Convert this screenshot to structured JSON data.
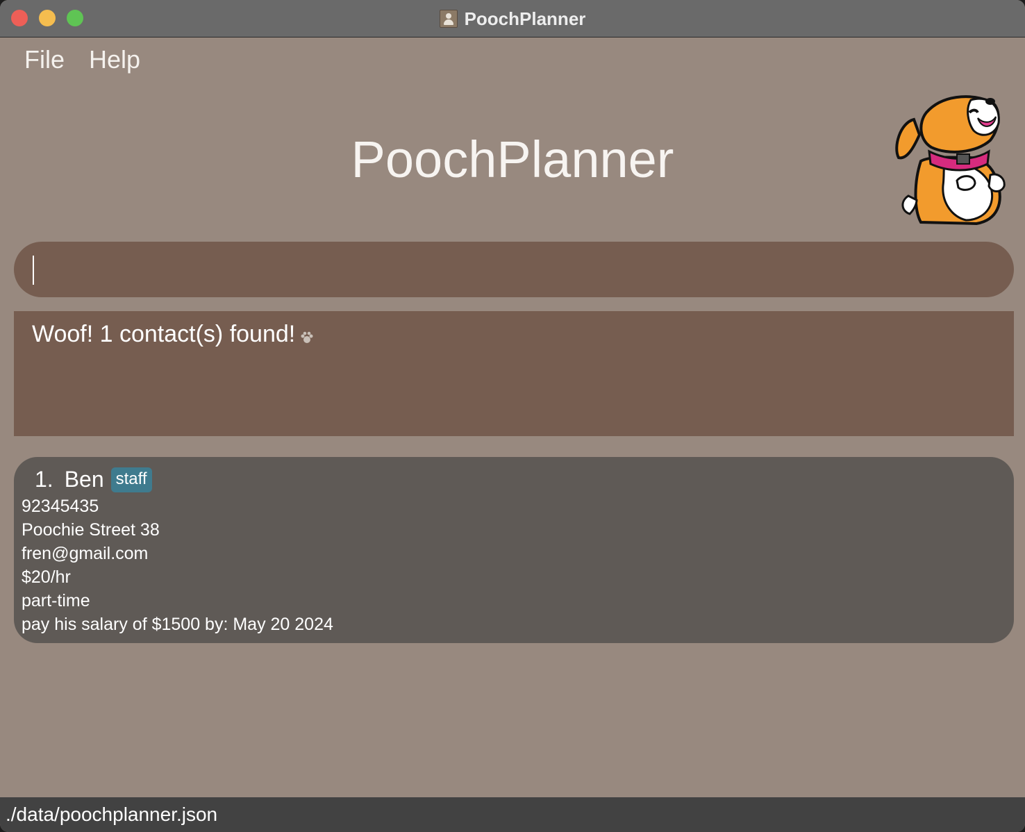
{
  "window": {
    "title": "PoochPlanner",
    "app_icon": "contact-book-icon"
  },
  "menu": {
    "file": "File",
    "help": "Help"
  },
  "header": {
    "app_title": "PoochPlanner",
    "mascot": "corgi-mascot-image"
  },
  "command": {
    "value": "",
    "placeholder": ""
  },
  "result": {
    "message": "Woof! 1 contact(s) found!",
    "icon": "paw-icon"
  },
  "contacts": [
    {
      "index": "1.",
      "name": "Ben",
      "tag": "staff",
      "phone": "92345435",
      "address": "Poochie Street 38",
      "email": "fren@gmail.com",
      "salary": "$20/hr",
      "employment": "part-time",
      "note": "pay his salary of $1500 by: May 20 2024"
    }
  ],
  "status": {
    "file_path": "./data/poochplanner.json"
  },
  "colors": {
    "background": "#98897f",
    "titlebar": "#6a6a6a",
    "panel": "#765d50",
    "card": "#5f5a56",
    "tag": "#3f7b8e",
    "statusbar": "#424242"
  }
}
